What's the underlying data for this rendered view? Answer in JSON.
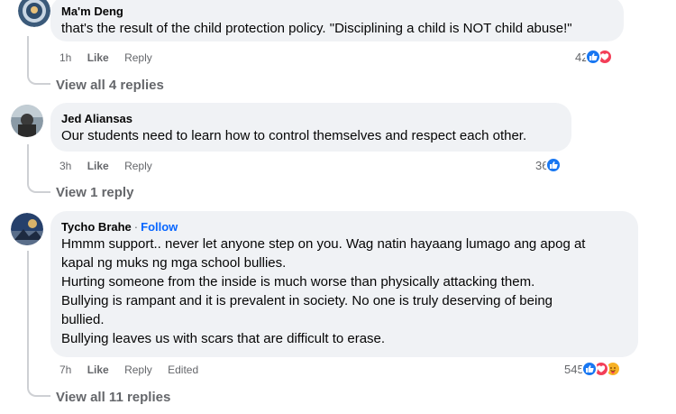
{
  "comments": [
    {
      "author": "Ma'm Deng",
      "lines": [
        "that's the result of the child protection policy. \"Disciplining a child is NOT child abuse!\""
      ],
      "time": "1h",
      "like": "Like",
      "reply": "Reply",
      "reaction_count": "42",
      "reactions": [
        "like-icon",
        "love-icon"
      ],
      "view_replies": "View all 4 replies"
    },
    {
      "author": "Jed Aliansas",
      "lines": [
        "Our students need to learn how to control themselves and respect each other."
      ],
      "time": "3h",
      "like": "Like",
      "reply": "Reply",
      "reaction_count": "36",
      "reactions": [
        "like-icon"
      ],
      "view_replies": "View 1 reply"
    },
    {
      "author": "Tycho Brahe",
      "separator": "·",
      "follow": "Follow",
      "lines": [
        "Hmmm support.. never let anyone step on you. Wag natin hayaang lumago ang apog at",
        "kapal ng muks ng mga school bullies.",
        "Hurting someone from the inside is much worse than physically attacking them.",
        "Bullying is rampant and it is prevalent in society. No one is truly deserving of being",
        "bullied.",
        "Bullying leaves us with scars that are difficult to erase."
      ],
      "time": "7h",
      "like": "Like",
      "reply": "Reply",
      "edited": "Edited",
      "reaction_count": "545",
      "reactions": [
        "like-icon",
        "love-icon",
        "care-icon"
      ],
      "view_replies": "View all 11 replies"
    }
  ],
  "colors": {
    "bubble": "#f0f2f5",
    "like_blue": "#1877f2",
    "love_red": "#f33e58",
    "care_yellow": "#f7b125",
    "meta_gray": "#65676b",
    "follow_blue": "#0866ff"
  }
}
